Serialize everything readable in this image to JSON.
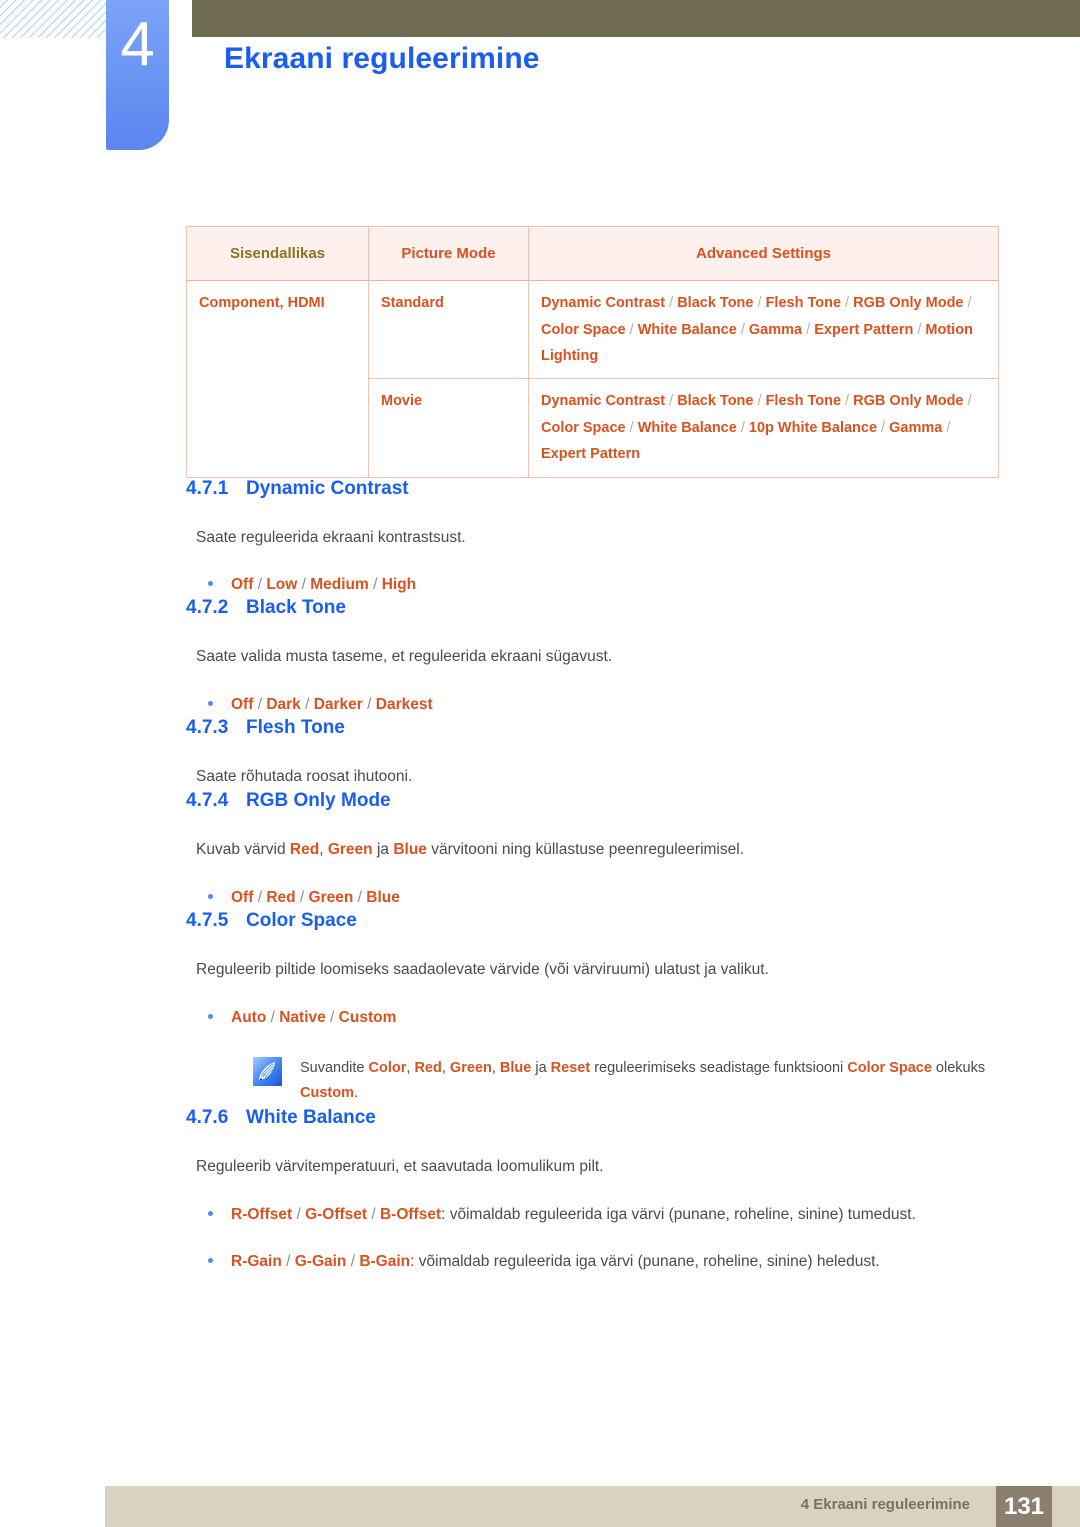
{
  "header": {
    "chapter_number": "4",
    "chapter_title": "Ekraani reguleerimine",
    "accent_blue": "#1a5ef0",
    "tab_blue": "#5a86ef",
    "olive_bar": "#6e6a54"
  },
  "table": {
    "columns": [
      "Sisendallikas",
      "Picture Mode",
      "Advanced Settings"
    ],
    "rows": [
      {
        "source": "Component, HDMI",
        "mode": "Standard",
        "advanced": "Dynamic Contrast / Black Tone / Flesh Tone / RGB Only Mode / Color Space / White Balance / Gamma / Expert Pattern / Motion Lighting"
      },
      {
        "source": "",
        "mode": "Movie",
        "advanced": "Dynamic Contrast / Black Tone / Flesh Tone / RGB Only Mode / Color Space / White Balance / 10p White Balance / Gamma / Expert Pattern"
      }
    ]
  },
  "sections": [
    {
      "number": "4.7.1",
      "title": "Dynamic Contrast",
      "body": "Saate reguleerida ekraani kontrastsust.",
      "bullet": "Off / Low / Medium / High"
    },
    {
      "number": "4.7.2",
      "title": "Black Tone",
      "body": "Saate valida musta taseme, et reguleerida ekraani sügavust.",
      "bullet": "Off / Dark / Darker / Darkest"
    },
    {
      "number": "4.7.3",
      "title": "Flesh Tone",
      "body": "Saate rõhutada roosat ihutooni."
    },
    {
      "number": "4.7.4",
      "title": "RGB Only Mode",
      "body_parts": {
        "p1": "Kuvab värvid ",
        "k1": "Red",
        "p2": ", ",
        "k2": "Green",
        "p3": " ja ",
        "k3": "Blue",
        "p4": " värvitooni ning küllastuse peenreguleerimisel."
      },
      "bullet": "Off / Red / Green / Blue"
    },
    {
      "number": "4.7.5",
      "title": "Color Space",
      "body": "Reguleerib piltide loomiseks saadaolevate värvide (või värviruumi) ulatust ja valikut.",
      "bullet": "Auto / Native / Custom",
      "note": {
        "icon": "note-quill-icon",
        "p1": "Suvandite ",
        "k1": "Color",
        "p2": ", ",
        "k2": "Red",
        "p3": ", ",
        "k3": "Green",
        "p4": ", ",
        "k4": "Blue",
        "p5": " ja ",
        "k5": "Reset",
        "p6": " reguleerimiseks seadistage funktsiooni ",
        "k6": "Color Space",
        "p7": " olekuks ",
        "k7": "Custom",
        "p8": "."
      }
    },
    {
      "number": "4.7.6",
      "title": "White Balance",
      "body": "Reguleerib värvitemperatuuri, et saavutada loomulikum pilt.",
      "bullets": [
        {
          "k1": "R-Offset",
          "s1": " / ",
          "k2": "G-Offset",
          "s2": " / ",
          "k3": "B-Offset",
          "rest": ": võimaldab reguleerida iga värvi (punane, roheline, sinine) tumedust."
        },
        {
          "k1": "R-Gain",
          "s1": " / ",
          "k2": "G-Gain",
          "s2": " / ",
          "k3": "B-Gain",
          "rest": ": võimaldab reguleerida iga värvi (punane, roheline, sinine) heledust."
        }
      ]
    }
  ],
  "bullet_tokens": {
    "dc": [
      "Off",
      "Low",
      "Medium",
      "High"
    ],
    "bt": [
      "Off",
      "Dark",
      "Darker",
      "Darkest"
    ],
    "rgb": [
      "Off",
      "Red",
      "Green",
      "Blue"
    ],
    "cs": [
      "Auto",
      "Native",
      "Custom"
    ]
  },
  "footer": {
    "text": "4 Ekraani reguleerimine",
    "page_number": "131"
  },
  "colors": {
    "orange": "#d9521f",
    "olive_text": "#8a7520",
    "body_gray": "#4b4b4b",
    "footer_bar": "#d8d2c0",
    "page_box": "#8d7f70"
  }
}
